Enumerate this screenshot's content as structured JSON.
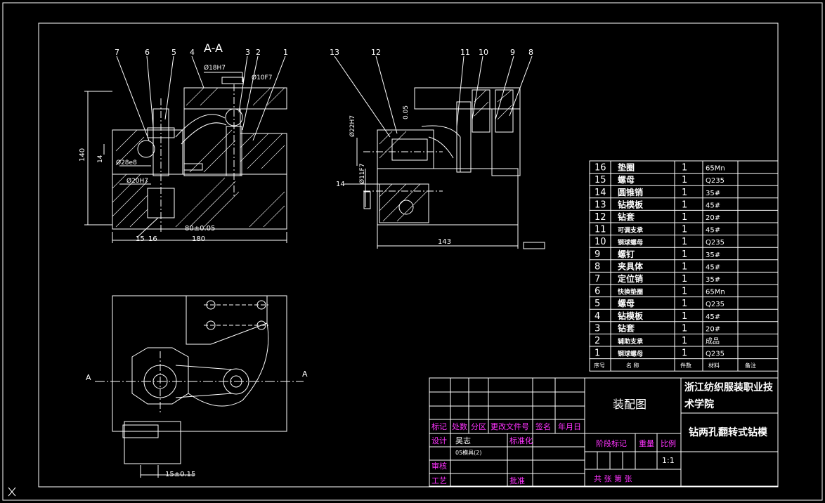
{
  "colors": {
    "background": "#000000",
    "line": "#ffffff",
    "table_text_magenta": "#ff33ff"
  },
  "section_title": "A-A",
  "section_mark": "A",
  "part_numbers_top": [
    "7",
    "6",
    "5",
    "4",
    "3",
    "2",
    "1",
    "13",
    "12",
    "11",
    "10",
    "9",
    "8"
  ],
  "part_number_14": "14",
  "dims": {
    "d18": "Ø18H7",
    "d10": "Ø10F7",
    "h140": "140",
    "h14": "14",
    "d28": "Ø28e8",
    "d20": "Ø20H7",
    "d80": "80±0.05",
    "d180": "180",
    "b15": "15",
    "b16": "16",
    "d22": "Ø22H7",
    "v0_05": "0.05",
    "d11": "Ø11F7",
    "d143": "143",
    "d15": "15±0.15"
  },
  "parts_table": [
    {
      "no": "16",
      "name": "垫圈",
      "qty": "1",
      "mat": "65Mn"
    },
    {
      "no": "15",
      "name": "螺母",
      "qty": "1",
      "mat": "Q235"
    },
    {
      "no": "14",
      "name": "圆锥销",
      "qty": "1",
      "mat": "35#"
    },
    {
      "no": "13",
      "name": "钻模板",
      "qty": "1",
      "mat": "45#"
    },
    {
      "no": "12",
      "name": "钻套",
      "qty": "1",
      "mat": "20#"
    },
    {
      "no": "11",
      "name": "可调支承",
      "qty": "1",
      "mat": "45#"
    },
    {
      "no": "10",
      "name": "钢球螺母",
      "qty": "1",
      "mat": "Q235"
    },
    {
      "no": "9",
      "name": "螺钉",
      "qty": "1",
      "mat": "35#"
    },
    {
      "no": "8",
      "name": "夹具体",
      "qty": "1",
      "mat": "45#"
    },
    {
      "no": "7",
      "name": "定位销",
      "qty": "1",
      "mat": "35#"
    },
    {
      "no": "6",
      "name": "快换垫圈",
      "qty": "1",
      "mat": "65Mn"
    },
    {
      "no": "5",
      "name": "螺母",
      "qty": "1",
      "mat": "Q235"
    },
    {
      "no": "4",
      "name": "钻模板",
      "qty": "1",
      "mat": "45#"
    },
    {
      "no": "3",
      "name": "钻套",
      "qty": "1",
      "mat": "20#"
    },
    {
      "no": "2",
      "name": "辅助支承",
      "qty": "1",
      "mat": "成品"
    },
    {
      "no": "1",
      "name": "钢球螺母",
      "qty": "1",
      "mat": "Q235"
    }
  ],
  "parts_header": {
    "no": "序号",
    "name": "名  称",
    "qty": "件数",
    "mat": "材料",
    "note": "备注"
  },
  "title_block": {
    "drawing_name": "装配图",
    "school": "浙江纺织服装职业技术学院",
    "product": "钻两孔翻转式钻模",
    "mark": "标记",
    "count": "处数",
    "zone": "分区",
    "doc_no": "更改文件号",
    "sign": "签名",
    "date": "年月日",
    "design": "设计",
    "designer": "吴志",
    "class": "05模具(2)",
    "std": "标准化",
    "stage": "阶段标记",
    "weight": "重量",
    "scale": "比例",
    "scale_val": "1:1",
    "review": "审核",
    "process": "工艺",
    "approve": "批准",
    "sheets": "共    张  第    张"
  }
}
